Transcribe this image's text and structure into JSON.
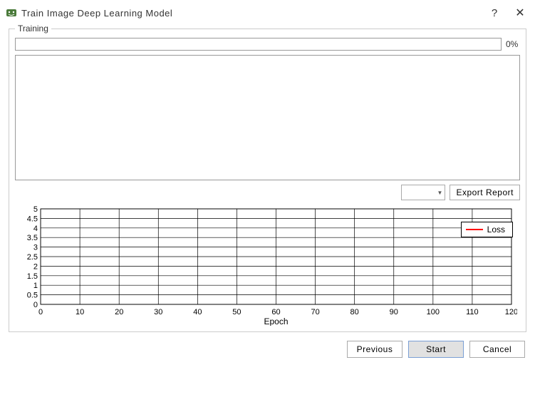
{
  "titlebar": {
    "title": "Train Image Deep Learning Model"
  },
  "fieldset": {
    "legend": "Training"
  },
  "progress": {
    "percent_label": "0%"
  },
  "export": {
    "button_label": "Export Report"
  },
  "chart_data": {
    "type": "line",
    "series": [
      {
        "name": "Loss",
        "values": []
      }
    ],
    "x": [],
    "xlabel": "Epoch",
    "ylabel": "",
    "xlim": [
      0,
      120
    ],
    "ylim": [
      0,
      5
    ],
    "xticks": [
      0,
      10,
      20,
      30,
      40,
      50,
      60,
      70,
      80,
      90,
      100,
      110,
      120
    ],
    "yticks": [
      0,
      0.5,
      1,
      1.5,
      2,
      2.5,
      3,
      3.5,
      4,
      4.5,
      5
    ],
    "legend_position": "upper-right",
    "legend_label": "Loss"
  },
  "footer": {
    "previous": "Previous",
    "start": "Start",
    "cancel": "Cancel"
  }
}
